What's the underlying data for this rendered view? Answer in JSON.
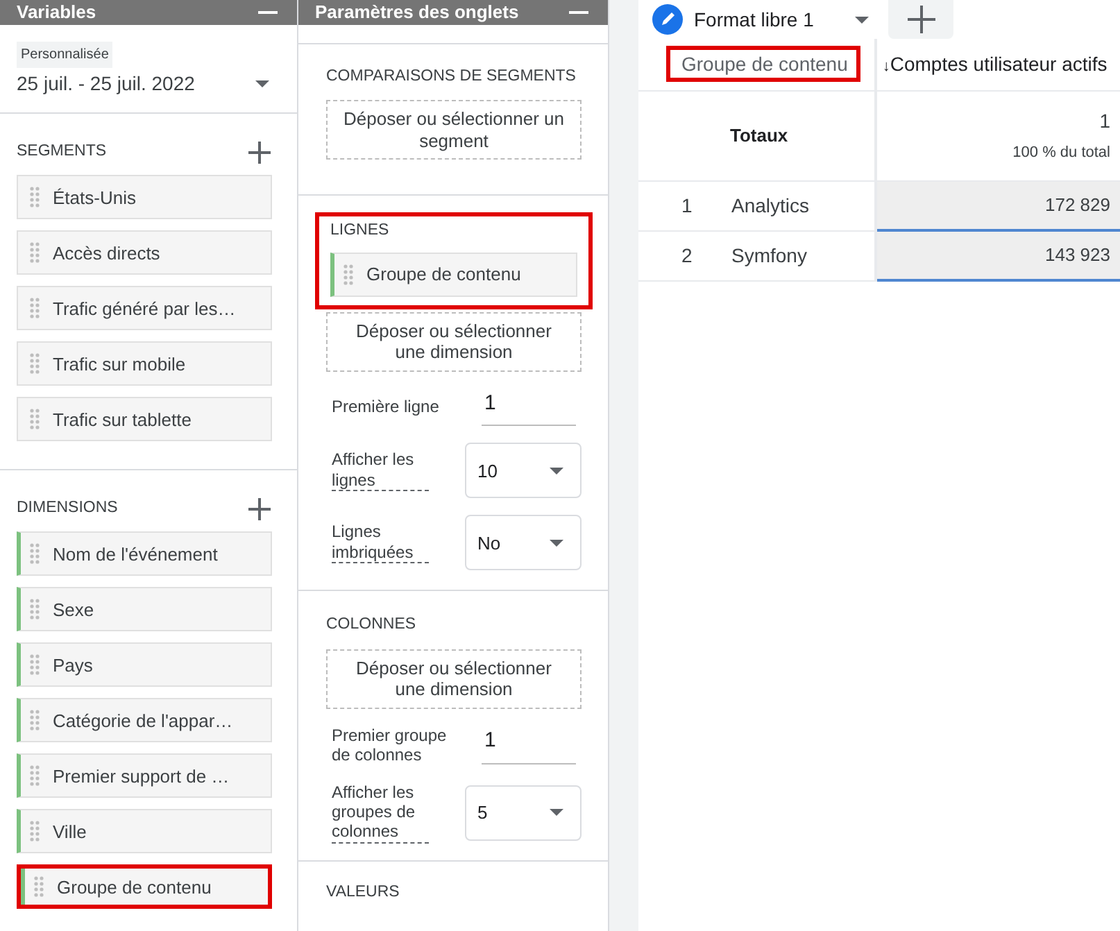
{
  "variables_panel": {
    "title": "Variables",
    "date_range": {
      "label": "Personnalisée",
      "value": "25 juil. - 25 juil. 2022"
    },
    "segments": {
      "heading": "SEGMENTS",
      "items": [
        {
          "label": "États-Unis",
          "highlighted": false
        },
        {
          "label": "Accès directs",
          "highlighted": false
        },
        {
          "label": "Trafic généré par les…",
          "highlighted": false
        },
        {
          "label": "Trafic sur mobile",
          "highlighted": false
        },
        {
          "label": "Trafic sur tablette",
          "highlighted": false
        }
      ]
    },
    "dimensions": {
      "heading": "DIMENSIONS",
      "items": [
        {
          "label": "Nom de l'événement",
          "highlighted": false
        },
        {
          "label": "Sexe",
          "highlighted": false
        },
        {
          "label": "Pays",
          "highlighted": false
        },
        {
          "label": "Catégorie de l'appar…",
          "highlighted": false
        },
        {
          "label": "Premier support de …",
          "highlighted": false
        },
        {
          "label": "Ville",
          "highlighted": false
        },
        {
          "label": "Groupe de contenu",
          "highlighted": true
        }
      ]
    }
  },
  "tab_settings_panel": {
    "title": "Paramètres des onglets",
    "segment_comparisons": {
      "heading": "COMPARAISONS DE SEGMENTS",
      "drop_zone": "Déposer ou sélectionner un segment"
    },
    "rows": {
      "heading": "LIGNES",
      "highlighted": true,
      "items": [
        {
          "label": "Groupe de contenu"
        }
      ],
      "drop_zone": "Déposer ou sélectionner une dimension",
      "settings": [
        {
          "kind": "input",
          "label": "Première ligne",
          "value": "1"
        },
        {
          "kind": "select",
          "label": "Afficher les lignes",
          "value": "10"
        },
        {
          "kind": "select",
          "label": "Lignes imbriquées",
          "value": "No"
        }
      ]
    },
    "columns": {
      "heading": "COLONNES",
      "drop_zone": "Déposer ou sélectionner une dimension",
      "settings": [
        {
          "kind": "input",
          "label": "Premier groupe de colonnes",
          "value": "1"
        },
        {
          "kind": "select",
          "label": "Afficher les groupes de colonnes",
          "value": "5"
        }
      ]
    },
    "values": {
      "heading": "VALEURS"
    }
  },
  "report": {
    "tabs": [
      {
        "label": "Format libre 1",
        "selected": true
      }
    ],
    "table": {
      "dimension_header": {
        "label": "Groupe de contenu",
        "highlighted": true
      },
      "metric_header": {
        "sort_indicator": "↓",
        "label": "Comptes utilisateur actifs"
      },
      "totals": {
        "label": "Totaux",
        "value": "1",
        "share": "100 % du total"
      },
      "rows": [
        {
          "index": "1",
          "label": "Analytics",
          "value": "172 829"
        },
        {
          "index": "2",
          "label": "Symfony",
          "value": "143 923"
        }
      ]
    }
  }
}
